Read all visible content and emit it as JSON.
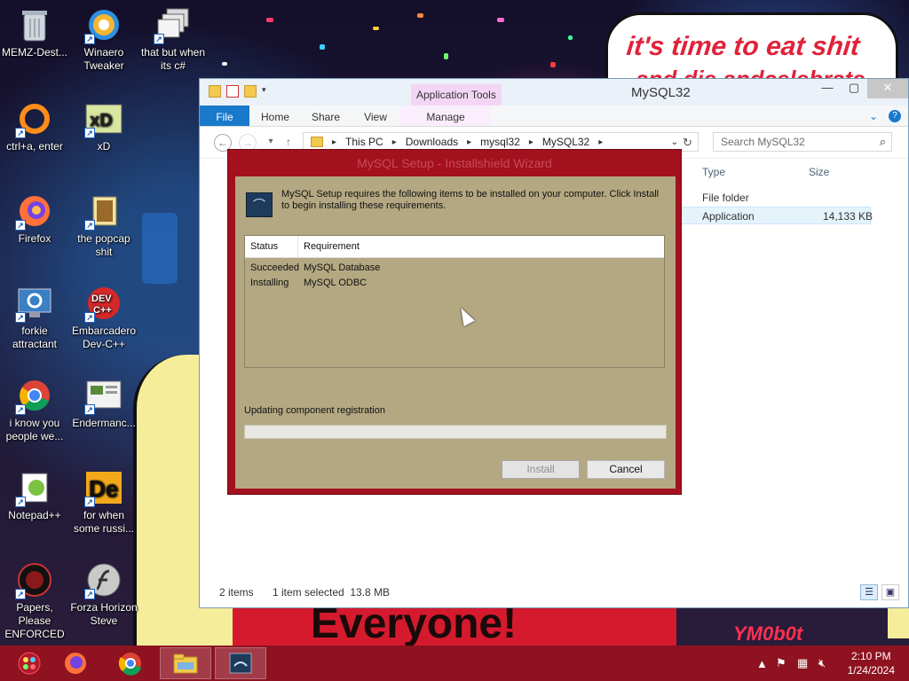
{
  "desktop": {
    "wallpaper_text": {
      "speech_line1": "it's time to eat shit",
      "speech_line2": "and die andcelebrate",
      "banner": "Everyone!",
      "neon": "YM0b0t"
    },
    "icons": [
      {
        "label": "MEMZ-Dest...",
        "icon": "recycle-bin-icon"
      },
      {
        "label": "Winaero Tweaker",
        "icon": "winaero-icon"
      },
      {
        "label": "that but when its c#",
        "icon": "windows-stack-icon"
      },
      {
        "label": "ctrl+a, enter",
        "icon": "ring-icon"
      },
      {
        "label": "xD",
        "icon": "hxd-icon"
      },
      {
        "label": "Firefox",
        "icon": "firefox-icon"
      },
      {
        "label": "the popcap shit",
        "icon": "popcap-icon"
      },
      {
        "label": "forkie attractant",
        "icon": "monitor-gear-icon"
      },
      {
        "label": "Embarcadero Dev-C++",
        "icon": "devcpp-icon"
      },
      {
        "label": "i know you people we...",
        "icon": "chrome-icon"
      },
      {
        "label": "Endermanc...",
        "icon": "endermanch-icon"
      },
      {
        "label": "Notepad++",
        "icon": "notepadpp-icon"
      },
      {
        "label": "for when some russi...",
        "icon": "de-icon"
      },
      {
        "label": "Papers, Please ENFORCED",
        "icon": "papers-please-icon"
      },
      {
        "label": "Forza Horizon Steve",
        "icon": "flash-icon"
      }
    ]
  },
  "explorer": {
    "title": "MySQL32",
    "contextual_tab": "Application Tools",
    "tabs": [
      "File",
      "Home",
      "Share",
      "View",
      "Manage"
    ],
    "breadcrumb": [
      "This PC",
      "Downloads",
      "mysql32",
      "MySQL32"
    ],
    "search_placeholder": "Search MySQL32",
    "columns": {
      "type": "Type",
      "size": "Size"
    },
    "rows": [
      {
        "type": "File folder",
        "size": ""
      },
      {
        "type": "Application",
        "size": "14,133 KB"
      }
    ],
    "status": {
      "items": "2 items",
      "selected": "1 item selected  13.8 MB"
    }
  },
  "dialog": {
    "title": "MySQL Setup - Installshield Wizard",
    "message": "MySQL Setup requires the following items to be installed on your computer. Click Install to begin installing these requirements.",
    "table_headers": {
      "status": "Status",
      "requirement": "Requirement"
    },
    "requirements": [
      {
        "status": "Succeeded",
        "requirement": "MySQL Database"
      },
      {
        "status": "Installing",
        "requirement": "MySQL ODBC"
      }
    ],
    "progress_label": "Updating component registration",
    "progress_value": 0.0,
    "install_label": "Install",
    "cancel_label": "Cancel"
  },
  "taskbar": {
    "time": "2:10 PM",
    "date": "1/24/2024",
    "items": [
      "start-orb-icon",
      "firefox-icon",
      "chrome-icon",
      "file-explorer-icon",
      "mysql-setup-icon"
    ]
  },
  "colors": {
    "dialog_frame": "#a3111e",
    "dialog_body": "#b3a882",
    "taskbar": "#8e1220",
    "ribbon_file": "#1979ca"
  }
}
